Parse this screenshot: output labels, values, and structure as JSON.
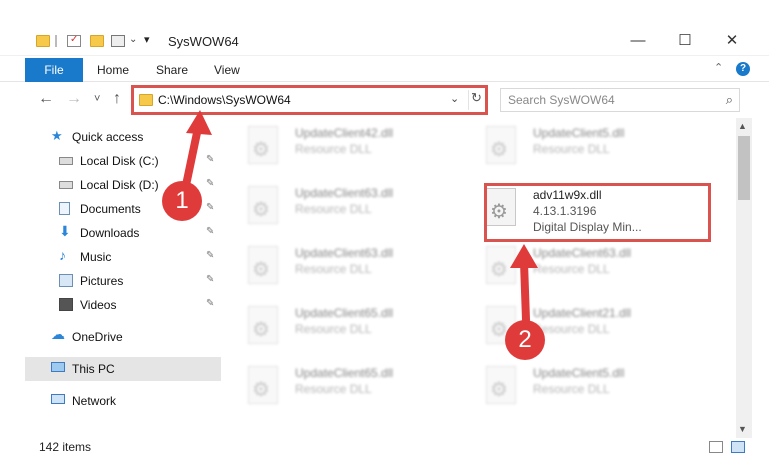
{
  "window": {
    "title": "SysWOW64",
    "minimize": "—",
    "maximize": "☐",
    "close": "✕",
    "qat_dropdown": "▾"
  },
  "ribbon": {
    "file_label": "File",
    "tabs": [
      "Home",
      "Share",
      "View"
    ],
    "help": "?",
    "collapse": "⌃"
  },
  "nav": {
    "back": "←",
    "forward": "→",
    "recent": "˅",
    "up": "↑",
    "address": "C:\\Windows\\SysWOW64",
    "address_dropdown": "⌄",
    "refresh": "↻",
    "search_placeholder": "Search SysWOW64",
    "search_icon": "⌕"
  },
  "sidebar": {
    "items": [
      {
        "label": "Quick access",
        "icon": "star-icon",
        "pinned": false
      },
      {
        "label": "Local Disk (C:)",
        "icon": "drive-icon",
        "pinned": true
      },
      {
        "label": "Local Disk (D:)",
        "icon": "drive-icon",
        "pinned": true
      },
      {
        "label": "Documents",
        "icon": "documents-icon",
        "pinned": true
      },
      {
        "label": "Downloads",
        "icon": "download-icon",
        "pinned": true
      },
      {
        "label": "Music",
        "icon": "music-icon",
        "pinned": true
      },
      {
        "label": "Pictures",
        "icon": "pictures-icon",
        "pinned": true
      },
      {
        "label": "Videos",
        "icon": "videos-icon",
        "pinned": false
      },
      {
        "label": "OneDrive",
        "icon": "cloud-icon",
        "pinned": false
      },
      {
        "label": "This PC",
        "icon": "computer-icon",
        "pinned": false,
        "selected": true
      },
      {
        "label": "Network",
        "icon": "network-icon",
        "pinned": false
      }
    ],
    "pin_glyph": "📌"
  },
  "files": [
    {
      "name": "UpdateClient42.dll",
      "desc": "Resource DLL"
    },
    {
      "name": "UpdateClient5.dll",
      "desc": "Resource DLL"
    },
    {
      "name": "UpdateClient63.dll",
      "desc": "Resource DLL"
    },
    {
      "name": "adv11w9x.dll",
      "desc": "4.13.1.3196",
      "desc2": "Digital Display Min..."
    },
    {
      "name": "UpdateClient63.dll",
      "desc": "Resource DLL"
    },
    {
      "name": "UpdateClient63.dll",
      "desc": "Resource DLL"
    },
    {
      "name": "UpdateClient65.dll",
      "desc": "Resource DLL"
    },
    {
      "name": "UpdateClient21.dll",
      "desc": "Resource DLL"
    },
    {
      "name": "UpdateClient65.dll",
      "desc": "Resource DLL"
    },
    {
      "name": "UpdateClient5.dll",
      "desc": "Resource DLL"
    }
  ],
  "status": {
    "items_count": "142 items"
  },
  "annotations": {
    "badge1": "1",
    "badge2": "2",
    "color": "#e03b3b"
  },
  "colors": {
    "accent": "#1979ca",
    "highlight": "#d9534f",
    "folder": "#f6c94a"
  }
}
